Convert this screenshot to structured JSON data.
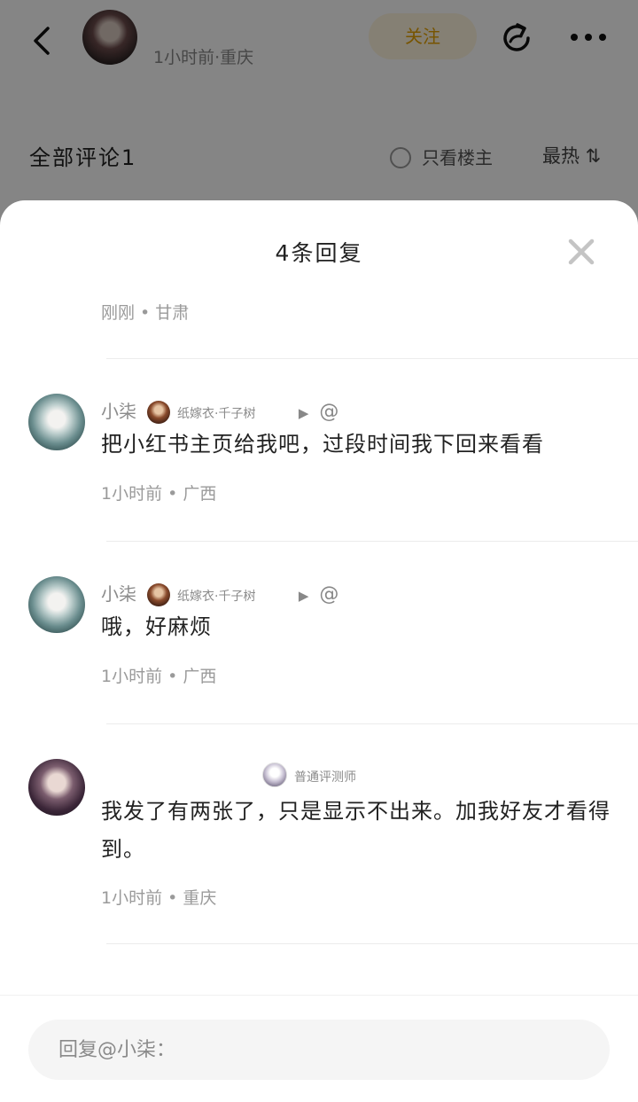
{
  "background": {
    "author_meta": "1小时前·重庆",
    "follow_label": "关注",
    "comments_count_label": "全部评论1",
    "only_author_label": "只看楼主",
    "sort_label": "最热 ⇅"
  },
  "sheet": {
    "title": "4条回复",
    "previous_meta": "刚刚 • 甘肃",
    "replies": [
      {
        "name": "小柒",
        "badge": "纸嫁衣·千子树",
        "content": "把小红书主页给我吧，过段时间我下回来看看",
        "meta": "1小时前 • 广西"
      },
      {
        "name": "小柒",
        "badge": "纸嫁衣·千子树",
        "content": "哦，好麻烦",
        "meta": "1小时前 • 广西"
      },
      {
        "name": "",
        "badge": "普通评测师",
        "content": "我发了有两张了，只是显示不出来。加我好友才看得到。",
        "meta": "1小时前 • 重庆"
      }
    ]
  },
  "input": {
    "placeholder": "回复@小柒："
  },
  "colors": {
    "accent": "#e5a100",
    "overlay": "rgba(0,0,0,0.48)"
  }
}
